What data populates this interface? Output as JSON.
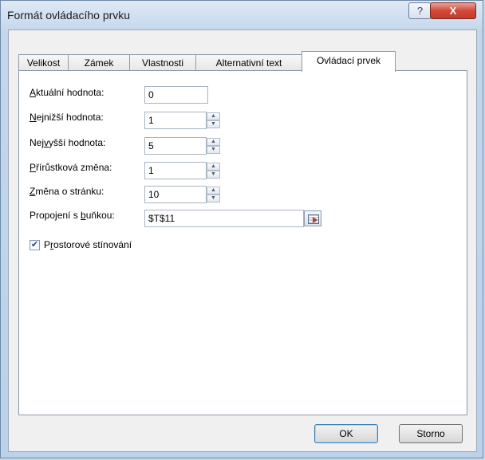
{
  "window": {
    "title": "Formát ovládacího prvku",
    "help_glyph": "?",
    "close_glyph": "X"
  },
  "tabs": [
    {
      "label": "Velikost",
      "active": false
    },
    {
      "label": "Zámek",
      "active": false
    },
    {
      "label": "Vlastnosti",
      "active": false
    },
    {
      "label": "Alternativní text",
      "active": false
    },
    {
      "label": "Ovládací prvek",
      "active": true
    }
  ],
  "fields": {
    "current_value": {
      "label_pre": "",
      "label_u": "A",
      "label_post": "ktuální hodnota:",
      "value": "0"
    },
    "min_value": {
      "label_pre": "",
      "label_u": "N",
      "label_post": "ejnižší hodnota:",
      "value": "1"
    },
    "max_value": {
      "label_pre": "Nej",
      "label_u": "v",
      "label_post": "yšší hodnota:",
      "value": "5"
    },
    "increment": {
      "label_pre": "",
      "label_u": "P",
      "label_post": "řírůstková změna:",
      "value": "1"
    },
    "page_change": {
      "label_pre": "",
      "label_u": "Z",
      "label_post": "měna o stránku:",
      "value": "10"
    },
    "cell_link": {
      "label_pre": "Propojení s ",
      "label_u": "b",
      "label_post": "uňkou:",
      "value": "$T$11"
    }
  },
  "shading": {
    "checked": true,
    "check_glyph": "✔",
    "label_pre": "P",
    "label_u": "r",
    "label_post": "ostorové stínování"
  },
  "buttons": {
    "ok": "OK",
    "cancel": "Storno"
  },
  "icons": {
    "spin_up": "▲",
    "spin_down": "▼"
  }
}
